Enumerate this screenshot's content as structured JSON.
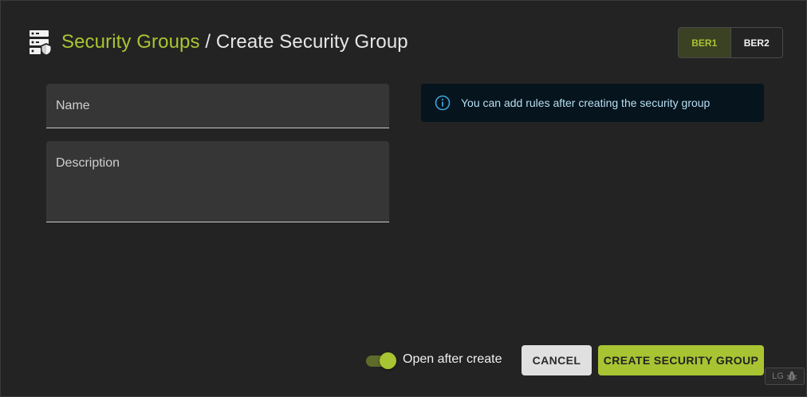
{
  "header": {
    "icon": "server-shield-icon",
    "breadcrumb_link": "Security Groups",
    "separator": " / ",
    "current": "Create Security Group"
  },
  "region_toggle": {
    "options": [
      "BER1",
      "BER2"
    ],
    "selected": "BER1"
  },
  "form": {
    "name_label": "Name",
    "name_value": "",
    "description_label": "Description",
    "description_value": ""
  },
  "info": {
    "icon": "info-circle-icon",
    "text": "You can add rules after creating the security group"
  },
  "footer": {
    "toggle_label": "Open after create",
    "toggle_on": true,
    "cancel_label": "CANCEL",
    "create_label": "CREATE SECURITY GROUP"
  },
  "badge": {
    "text": "LG",
    "icon": "bug-icon"
  },
  "colors": {
    "accent": "#a9c432",
    "background": "#232323",
    "field_bg": "#363636",
    "info_bg": "#06141d",
    "info_text": "#b7dff2"
  }
}
